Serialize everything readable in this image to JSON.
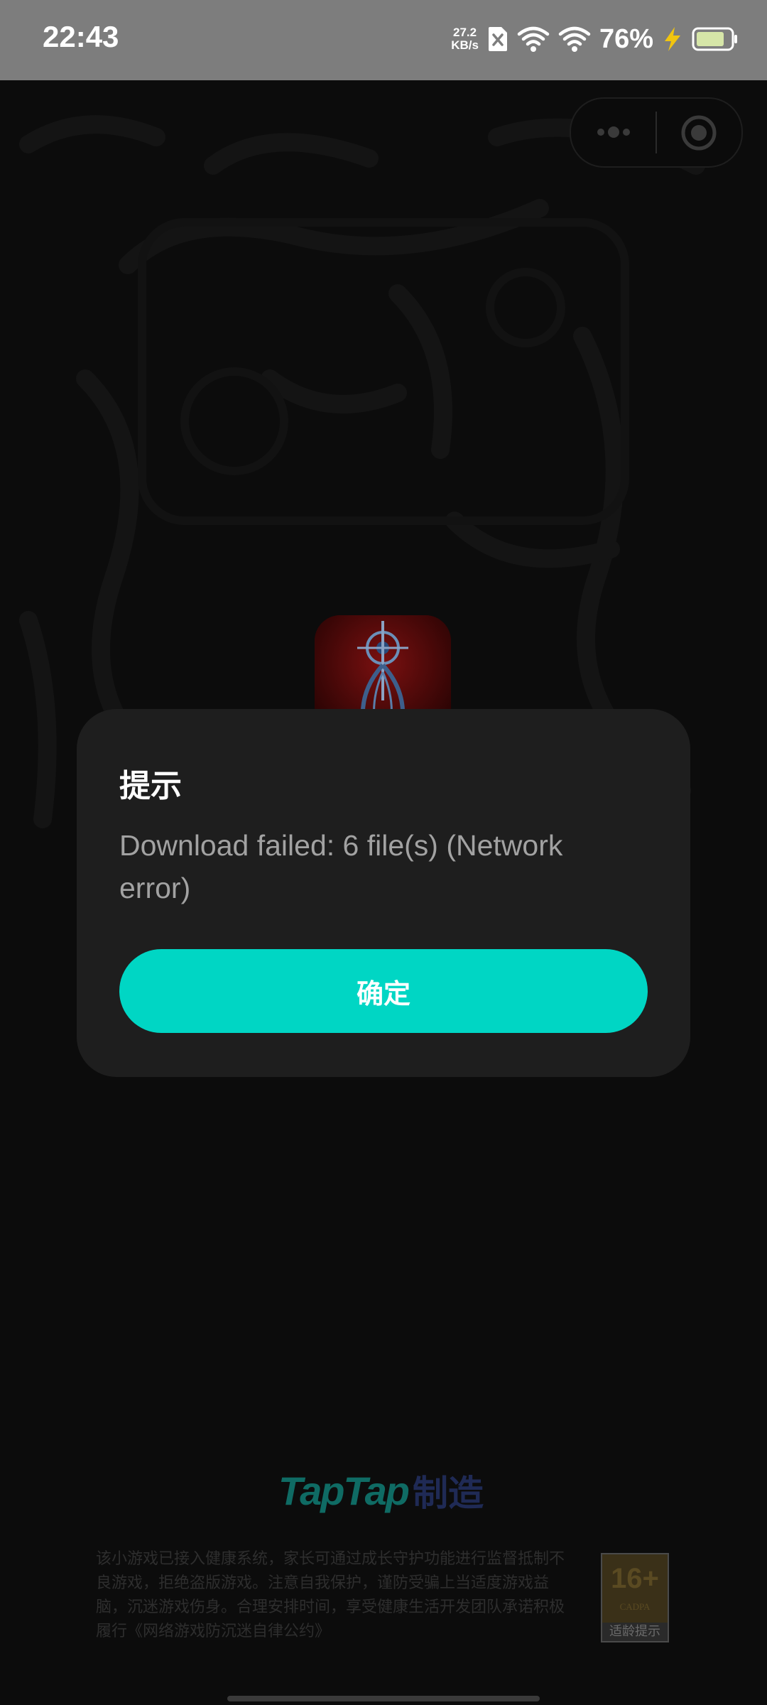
{
  "status_bar": {
    "time": "22:43",
    "net_speed_value": "27.2",
    "net_speed_unit": "KB/s",
    "battery_percent": "76%"
  },
  "capsule": {
    "more_icon": "more-dots-icon",
    "close_icon": "target-close-icon"
  },
  "dialog": {
    "title": "提示",
    "message": "Download failed: 6 file(s) (Network error)",
    "confirm_label": "确定",
    "accent_color": "#00d6c4"
  },
  "footer": {
    "brand_word": "TapTap",
    "brand_suffix": "制造",
    "health_notice": "该小游戏已接入健康系统，家长可通过成长守护功能进行监督抵制不良游戏，拒绝盗版游戏。注意自我保护，谨防受骗上当适度游戏益脑，沉迷游戏伤身。合理安排时间，享受健康生活开发团队承诺积极履行《网络游戏防沉迷自律公约》",
    "age_rating": "16+",
    "age_org": "CADPA",
    "age_tip": "适龄提示"
  }
}
